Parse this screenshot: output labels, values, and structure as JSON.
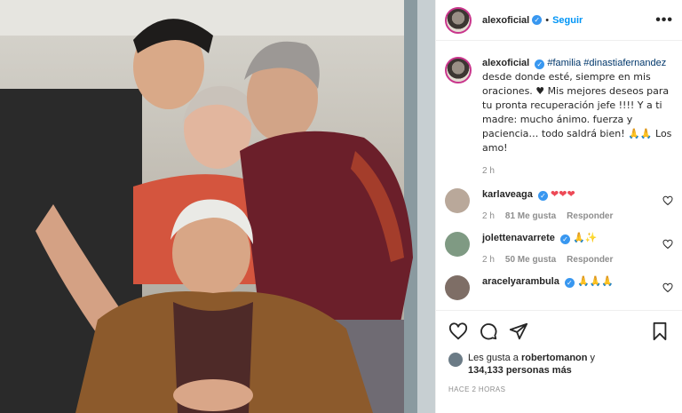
{
  "header": {
    "username": "alexoficial",
    "dot": "•",
    "follow_label": "Seguir",
    "more_label": "•••"
  },
  "caption": {
    "username": "alexoficial",
    "hashtag1": "#familia",
    "hashtag2": "#dinastiafernandez",
    "text": "desde donde esté, siempre en mis oraciones. ♥ Mis mejores deseos para tu pronta recuperación jefe !!!! Y a ti madre: mucho ánimo. fuerza y paciencia… todo saldrá bien! 🙏🙏 Los amo!",
    "time": "2 h"
  },
  "comments": [
    {
      "username": "karlaveaga",
      "text": "❤❤❤",
      "time": "2 h",
      "likes": "81 Me gusta",
      "reply": "Responder",
      "avatar_color": "#b9a89a"
    },
    {
      "username": "jolettenavarrete",
      "text": "🙏✨",
      "time": "2 h",
      "likes": "50 Me gusta",
      "reply": "Responder",
      "avatar_color": "#7f9a83"
    },
    {
      "username": "aracelyarambula",
      "text": "🙏🙏🙏",
      "avatar_color": "#7e6e66"
    }
  ],
  "likes": {
    "prefix": "Les gusta a ",
    "user": "robertomanon",
    "suffix": " y",
    "others": "134,133 personas más"
  },
  "posted": "HACE 2 HORAS",
  "colors": {
    "accent": "#0095f6",
    "hashtag": "#00376b",
    "muted": "#8e8e8e",
    "heart": "#ed4956"
  }
}
